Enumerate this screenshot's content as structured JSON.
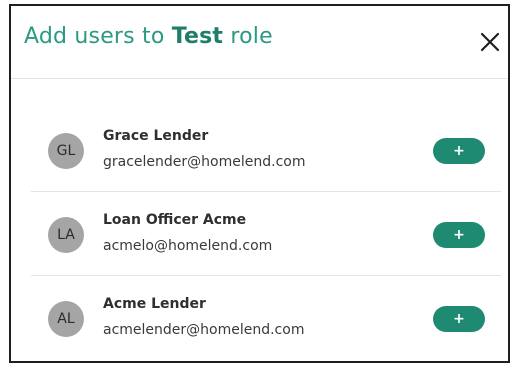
{
  "dialog": {
    "title_prefix": "Add users to ",
    "role_name": "Test",
    "title_suffix": " role",
    "close_icon": "close-icon"
  },
  "users": [
    {
      "initials": "GL",
      "name": "Grace Lender",
      "email": "gracelender@homelend.com",
      "add_label": "+"
    },
    {
      "initials": "LA",
      "name": "Loan Officer Acme",
      "email": "acmelo@homelend.com",
      "add_label": "+"
    },
    {
      "initials": "AL",
      "name": "Acme Lender",
      "email": "acmelender@homelend.com",
      "add_label": "+"
    }
  ],
  "colors": {
    "accent": "#2a9a83",
    "button": "#1f8a72",
    "avatar": "#a5a5a5"
  }
}
